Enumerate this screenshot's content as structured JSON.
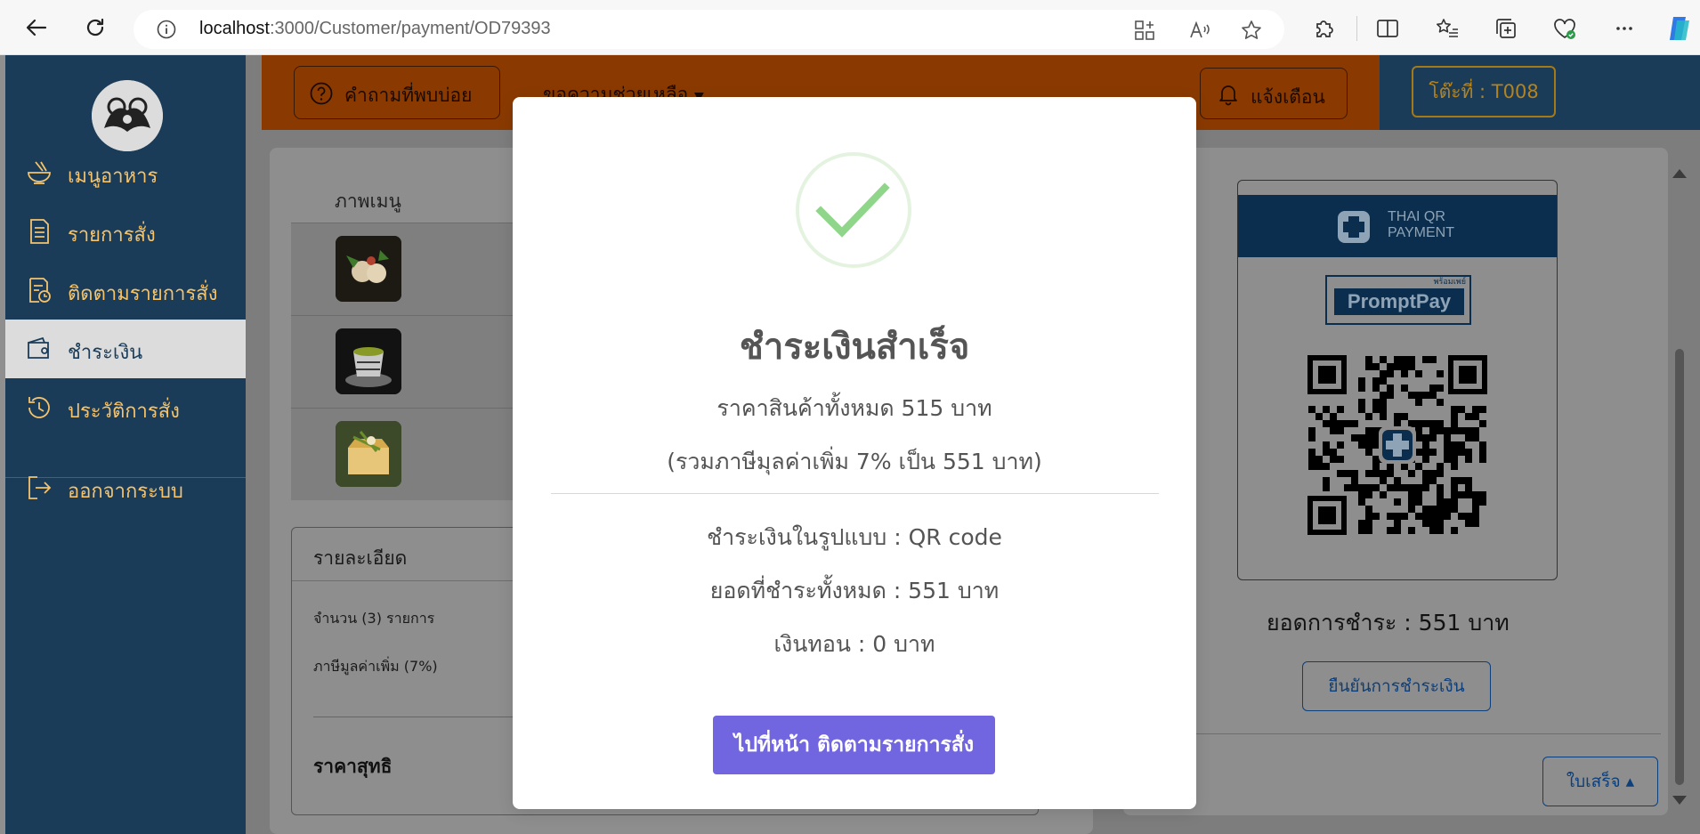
{
  "browser": {
    "url_host": "localhost",
    "url_path": ":3000/Customer/payment/OD79393"
  },
  "sidebar": {
    "items": [
      {
        "label": "เมนูอาหาร",
        "icon": "food-bowl-icon"
      },
      {
        "label": "รายการสั่ง",
        "icon": "order-list-icon"
      },
      {
        "label": "ติดตามรายการสั่ง",
        "icon": "track-order-icon"
      },
      {
        "label": "ชำระเงิน",
        "icon": "wallet-icon",
        "active": true
      },
      {
        "label": "ประวัติการสั่ง",
        "icon": "history-clock-icon"
      },
      {
        "label": "ออกจากระบบ",
        "icon": "logout-icon"
      }
    ]
  },
  "header": {
    "faq_label": "คำถามที่พบบ่อย",
    "help_menu_label": "ขอความช่วยเหลือ",
    "notify_label": "แจ้งเตือน",
    "table_label": "โต๊ะที่ : T008"
  },
  "menu_table": {
    "column_header": "ภาพเมนู",
    "rows": [
      {
        "thumb": "sushi-dish-image"
      },
      {
        "thumb": "green-tea-cup-image"
      },
      {
        "thumb": "toast-dessert-image"
      }
    ]
  },
  "details": {
    "title": "รายละเอียด",
    "quantity_label": "จำนวน (3) รายการ",
    "vat_label": "ภาษีมูลค่าเพิ่ม (7%)",
    "net_label": "ราคาสุทธิ"
  },
  "qr_panel": {
    "header_text": "THAI QR\nPAYMENT",
    "promptpay_word": "PromptPay",
    "promptpay_small": "พร้อมเพย์",
    "total_label": "ยอดการชำระ : 551 บาท",
    "confirm_label": "ยืนยันการชำระเงิน",
    "receipt_label": "ใบเสร็จ ▴"
  },
  "modal": {
    "title": "ชำระเงินสำเร็จ",
    "subtotal": "ราคาสินค้าทั้งหมด 515 บาท",
    "vat_note": "(รวมภาษีมุลค่าเพิ่ม 7% เป็น 551 บาท)",
    "method": "ชำระเงินในรูปแบบ : QR code",
    "paid_total": "ยอดที่ชำระทั้งหมด : 551 บาท",
    "change": "เงินทอน : 0 บาท",
    "button_label": "ไปที่หน้า ติดตามรายการสั่ง"
  },
  "colors": {
    "sidebar_bg": "#1b3c59",
    "sidebar_text": "#f4c36c",
    "header_orange": "#e06b00",
    "success_green": "#8fd68a",
    "button_purple": "#7266e0"
  }
}
